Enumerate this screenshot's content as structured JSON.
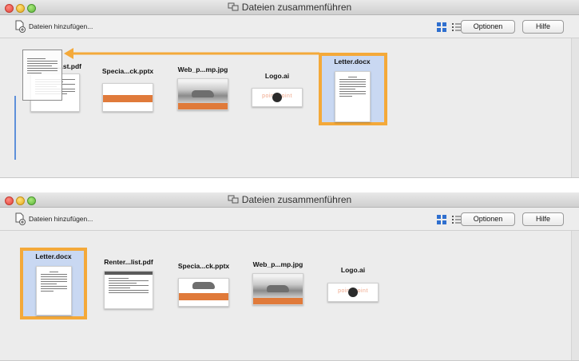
{
  "window_title": "Dateien zusammenführen",
  "toolbar": {
    "add_label": "Dateien hinzufügen...",
    "options_label": "Optionen",
    "help_label": "Hilfe"
  },
  "top_panel": {
    "files": [
      {
        "label": "...st.pdf",
        "type": "pdf"
      },
      {
        "label": "Specia...ck.pptx",
        "type": "pptx"
      },
      {
        "label": "Web_p...mp.jpg",
        "type": "jpg"
      },
      {
        "label": "Logo.ai",
        "type": "ai"
      },
      {
        "label": "Letter.docx",
        "type": "docx",
        "selected": true
      }
    ]
  },
  "bottom_panel": {
    "files": [
      {
        "label": "Letter.docx",
        "type": "docx",
        "selected": true
      },
      {
        "label": "Renter...list.pdf",
        "type": "pdf"
      },
      {
        "label": "Specia...ck.pptx",
        "type": "pptx"
      },
      {
        "label": "Web_p...mp.jpg",
        "type": "jpg"
      },
      {
        "label": "Logo.ai",
        "type": "ai"
      }
    ]
  },
  "logo_text": "point   point",
  "colors": {
    "selection_border": "#f4a93a",
    "selection_fill": "#c9d8f2",
    "accent_orange": "#e07a3a",
    "grid_icon_blue": "#2f6fcf"
  }
}
